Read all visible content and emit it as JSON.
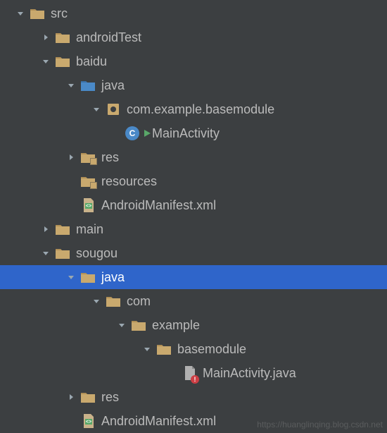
{
  "watermark": "https://huanglinqing.blog.csdn.net",
  "tree": [
    {
      "depth": 0,
      "arrow": "down",
      "icon": "folder",
      "label": "src"
    },
    {
      "depth": 1,
      "arrow": "right",
      "icon": "folder",
      "label": "androidTest"
    },
    {
      "depth": 1,
      "arrow": "down",
      "icon": "folder",
      "label": "baidu"
    },
    {
      "depth": 2,
      "arrow": "down",
      "icon": "folder-src",
      "label": "java"
    },
    {
      "depth": 3,
      "arrow": "down",
      "icon": "package",
      "label": "com.example.basemodule"
    },
    {
      "depth": 4,
      "arrow": "none",
      "icon": "class-run",
      "label": "MainActivity"
    },
    {
      "depth": 2,
      "arrow": "right",
      "icon": "folder-res",
      "label": "res"
    },
    {
      "depth": 2,
      "arrow": "none",
      "icon": "folder-res",
      "label": "resources"
    },
    {
      "depth": 2,
      "arrow": "none",
      "icon": "xml",
      "label": "AndroidManifest.xml"
    },
    {
      "depth": 1,
      "arrow": "right",
      "icon": "folder",
      "label": "main"
    },
    {
      "depth": 1,
      "arrow": "down",
      "icon": "folder",
      "label": "sougou"
    },
    {
      "depth": 2,
      "arrow": "down",
      "icon": "folder",
      "label": "java",
      "selected": true
    },
    {
      "depth": 3,
      "arrow": "down",
      "icon": "folder",
      "label": "com"
    },
    {
      "depth": 4,
      "arrow": "down",
      "icon": "folder",
      "label": "example"
    },
    {
      "depth": 5,
      "arrow": "down",
      "icon": "folder",
      "label": "basemodule"
    },
    {
      "depth": 6,
      "arrow": "none",
      "icon": "file-error",
      "label": "MainActivity.java"
    },
    {
      "depth": 2,
      "arrow": "right",
      "icon": "folder",
      "label": "res"
    },
    {
      "depth": 2,
      "arrow": "none",
      "icon": "xml",
      "label": "AndroidManifest.xml"
    }
  ]
}
